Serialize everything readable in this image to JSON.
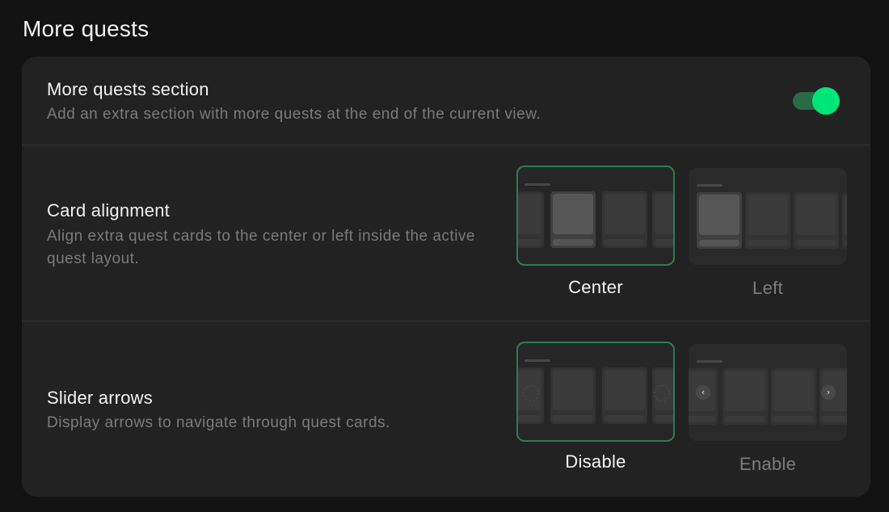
{
  "page": {
    "title": "More quests"
  },
  "more_quests_section": {
    "title": "More quests section",
    "description": "Add an extra section with more quests at the end of the current view.",
    "toggle_on": true
  },
  "card_alignment": {
    "title": "Card alignment",
    "description": "Align extra quest cards to the center or left inside the active quest layout.",
    "options": [
      {
        "label": "Center",
        "selected": true
      },
      {
        "label": "Left",
        "selected": false
      }
    ]
  },
  "slider_arrows": {
    "title": "Slider arrows",
    "description": "Display arrows to navigate through quest cards.",
    "options": [
      {
        "label": "Disable",
        "selected": true
      },
      {
        "label": "Enable",
        "selected": false
      }
    ],
    "prev_arrow_icon": "chevron-left-icon",
    "next_arrow_icon": "chevron-right-icon"
  },
  "colors": {
    "accent": "#00e676",
    "selected_border": "#2e7d4f",
    "panel": "#222222",
    "background": "#121212"
  }
}
